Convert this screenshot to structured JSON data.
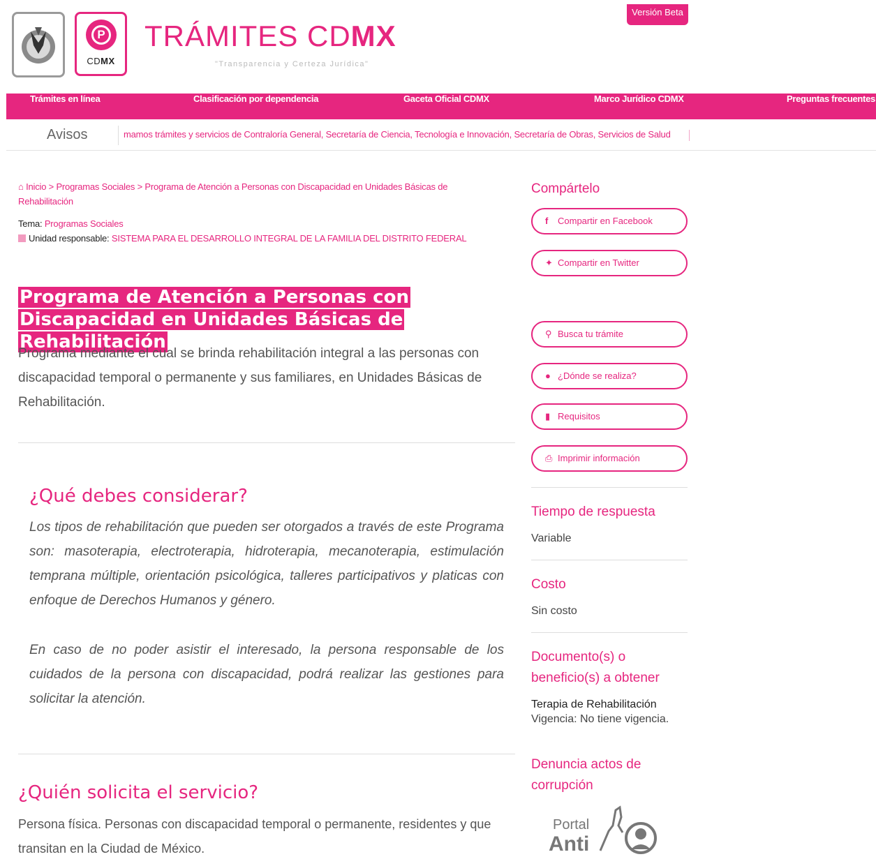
{
  "header": {
    "title_light": "TRÁMITES CD",
    "title_bold": "MX",
    "subtitle": "\"Transparencia y Certeza Jurídica\"",
    "beta_badge": "Versión Beta",
    "cdmx_logo_light": "CD",
    "cdmx_logo_bold": "MX"
  },
  "nav": {
    "items": [
      "Trámites en línea",
      "Clasificación por dependencia",
      "Gaceta Oficial CDMX",
      "Marco Jurídico CDMX",
      "Preguntas frecuentes"
    ]
  },
  "avisos": {
    "label": "Avisos",
    "ticker": "mamos trámites y servicios de Contraloría General, Secretaría de Ciencia, Tecnología e Innovación, Secretaría de Obras, Servicios de Salud"
  },
  "breadcrumb": {
    "home": "Inicio",
    "sep": " > ",
    "level1": "Programas Sociales",
    "current": "Programa de Atención a Personas con Discapacidad en Unidades Básicas de Rehabilitación"
  },
  "meta": {
    "tema_label": "Tema:",
    "tema_value": "Programas Sociales",
    "unidad_label": "Unidad responsable:",
    "unidad_value": "SISTEMA PARA EL DESARROLLO INTEGRAL DE LA FAMILIA DEL DISTRITO FEDERAL"
  },
  "main": {
    "title": "Programa de Atención a Personas con Discapacidad en Unidades Básicas de Rehabilitación",
    "description": "Programa mediante el cual se brinda rehabilitación integral a las personas con discapacidad temporal o permanente y sus familiares, en Unidades Básicas de Rehabilitación."
  },
  "considerar": {
    "heading": "¿Qué debes considerar?",
    "p1": "Los tipos de rehabilitación que pueden ser otorgados a través de este Programa son: masoterapia, electroterapia, hidroterapia, mecanoterapia, estimulación temprana múltiple, orientación psicológica, talleres participativos y platicas con enfoque de Derechos Humanos y género.",
    "p2": "En caso de no poder asistir el interesado, la persona responsable de los cuidados de la persona con discapacidad, podrá realizar las gestiones para solicitar la atención."
  },
  "solicita": {
    "heading": "¿Quién solicita el servicio?",
    "text": "Persona física. Personas con discapacidad temporal o permanente, residentes y que transitan en la Ciudad de México."
  },
  "sidebar": {
    "share_heading": "Compártelo",
    "facebook_label": "Compartir en Facebook",
    "twitter_label": "Compartir en Twitter",
    "busca_label": "Busca tu trámite",
    "donde_label": "¿Dónde se realiza?",
    "requisitos_label": "Requisitos",
    "imprimir_label": "Imprimir información",
    "tiempo_heading": "Tiempo de respuesta",
    "tiempo_value": "Variable",
    "costo_heading": "Costo",
    "costo_value": "Sin costo",
    "documento_heading": "Documento(s) o beneficio(s) a obtener",
    "documento_value": "Terapia de Rehabilitación",
    "vigencia_value": "Vigencia: No tiene vigencia.",
    "denuncia_heading": "Denuncia actos de corrupción",
    "portal_line1": "Portal",
    "portal_line2": "Anti"
  },
  "colors": {
    "accent": "#e6267f",
    "text": "#555555"
  },
  "icons": [
    "eagle-emblem-icon",
    "cdmx-logo-icon",
    "home-icon",
    "document-icon",
    "facebook-icon",
    "twitter-icon",
    "search-icon",
    "map-pin-icon",
    "document-icon",
    "printer-icon",
    "anticorruption-icon"
  ]
}
